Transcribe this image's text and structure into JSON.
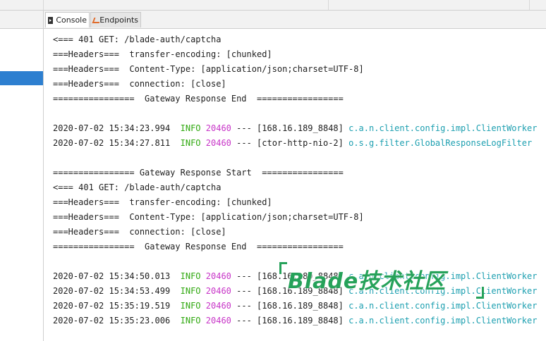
{
  "tabs": {
    "console_label": "Console",
    "endpoints_label": "Endpoints"
  },
  "colors": {
    "info": "#2fa80f",
    "pid": "#c734c7",
    "logger": "#1c9fb0",
    "selection": "#2d7fd0",
    "watermark": "#26a25a"
  },
  "output": {
    "lines": [
      {
        "text": "<=== 401 GET: /blade-auth/captcha"
      },
      {
        "text": "===Headers===  transfer-encoding: [chunked]"
      },
      {
        "text": "===Headers===  Content-Type: [application/json;charset=UTF-8]"
      },
      {
        "text": "===Headers===  connection: [close]"
      },
      {
        "text": "================  Gateway Response End  ================="
      },
      {
        "text": ""
      },
      {
        "ts": "2020-07-02 15:34:23.994",
        "level": "INFO",
        "pid": "20460",
        "sep": "---",
        "thread": "[168.16.189_8848]",
        "logger": "c.a.n.client.config.impl.ClientWorker"
      },
      {
        "ts": "2020-07-02 15:34:27.811",
        "level": "INFO",
        "pid": "20460",
        "sep": "---",
        "thread": "[ctor-http-nio-2]",
        "logger": "o.s.g.filter.GlobalResponseLogFilter"
      },
      {
        "text": ""
      },
      {
        "text": "================ Gateway Response Start  ================"
      },
      {
        "text": "<=== 401 GET: /blade-auth/captcha"
      },
      {
        "text": "===Headers===  transfer-encoding: [chunked]"
      },
      {
        "text": "===Headers===  Content-Type: [application/json;charset=UTF-8]"
      },
      {
        "text": "===Headers===  connection: [close]"
      },
      {
        "text": "================  Gateway Response End  ================="
      },
      {
        "text": ""
      },
      {
        "ts": "2020-07-02 15:34:50.013",
        "level": "INFO",
        "pid": "20460",
        "sep": "---",
        "thread": "[168.16.189_8848]",
        "logger": "c.a.n.client.config.impl.ClientWorker"
      },
      {
        "ts": "2020-07-02 15:34:53.499",
        "level": "INFO",
        "pid": "20460",
        "sep": "---",
        "thread": "[168.16.189_8848]",
        "logger": "c.a.n.client.config.impl.ClientWorker"
      },
      {
        "ts": "2020-07-02 15:35:19.519",
        "level": "INFO",
        "pid": "20460",
        "sep": "---",
        "thread": "[168.16.189_8848]",
        "logger": "c.a.n.client.config.impl.ClientWorker"
      },
      {
        "ts": "2020-07-02 15:35:23.006",
        "level": "INFO",
        "pid": "20460",
        "sep": "---",
        "thread": "[168.16.189_8848]",
        "logger": "c.a.n.client.config.impl.ClientWorker"
      }
    ]
  },
  "watermark": {
    "text": "Blade技术社区"
  }
}
